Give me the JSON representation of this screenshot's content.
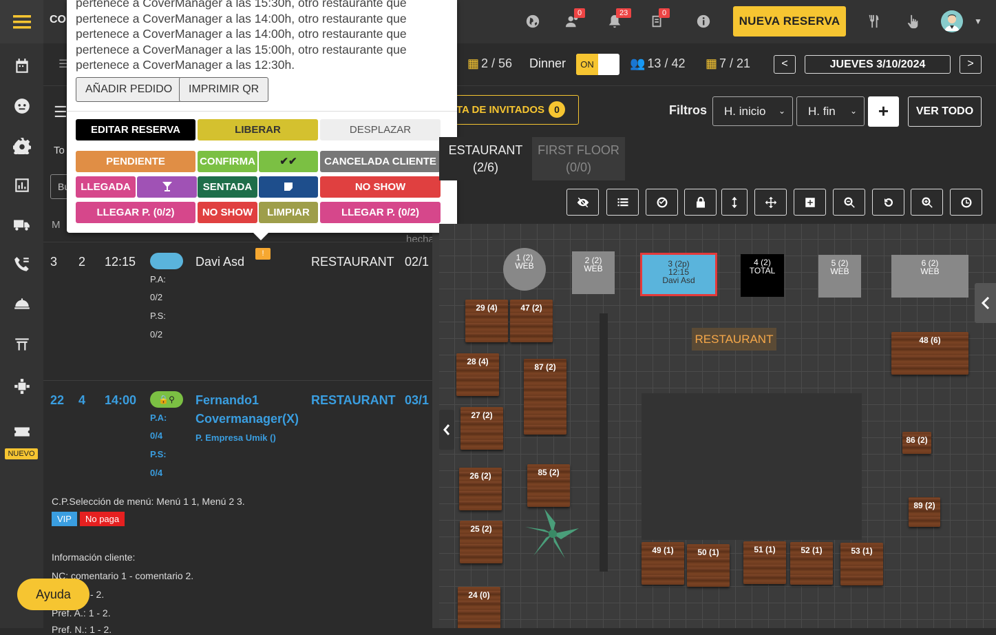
{
  "app": {
    "brand": "CO"
  },
  "sidebar": {
    "nuevo_badge": "NUEVO"
  },
  "topbar": {
    "badges": {
      "users": "0",
      "notifications": "23",
      "tasks": "0"
    },
    "new_reservation": "NUEVA RESERVA"
  },
  "stats": {
    "tables": "2 / 56",
    "service": "Dinner",
    "toggle": "ON",
    "people": "13 / 42",
    "tables2": "7 / 21"
  },
  "date": {
    "prev": "<",
    "label": "JUEVES 3/10/2024",
    "next": ">"
  },
  "filters": {
    "invitados_label": "TA DE INVITADOS",
    "invitados_count": "0",
    "label": "Filtros",
    "h_inicio": "H. inicio",
    "h_fin": "H. fin",
    "plus": "+",
    "ver_todo": "VER TODO"
  },
  "popup": {
    "text": "pertenece a CoverManager a las 15:30h, otro restaurante que pertenece a CoverManager a las 14:00h, otro restaurante que pertenece a CoverManager a las 14:00h, otro restaurante que pertenece a CoverManager a las 15:00h, otro restaurante que pertenece a CoverManager a las 12:30h.",
    "add_order": "AÑADIR PEDIDO",
    "print_qr": "IMPRIMIR QR",
    "actions": {
      "editar": "EDITAR RESERVA",
      "liberar": "LIBERAR",
      "desplazar": "DESPLAZAR",
      "pendiente": "PENDIENTE",
      "confirmada": "CONFIRMA",
      "double_check": "✔✔",
      "cancelada": "CANCELADA CLIENTE",
      "llegada": "LLEGADA",
      "sentada": "SENTADA",
      "no_show": "NO SHOW",
      "llegar_p1": "LLEGAR P. (0/2)",
      "no_show2": "NO SHOW",
      "limpiar": "LIMPIAR",
      "llegar_p2": "LLEGAR P. (0/2)"
    }
  },
  "left": {
    "tab_partial": "To",
    "search_partial": "Bu",
    "col_m": "M",
    "col_hecha": "hecha",
    "rows": [
      {
        "table": "3",
        "pax": "2",
        "time": "12:15",
        "name": "Davi Asd",
        "place": "RESTAURANT",
        "date": "02/1",
        "pa_label": "P.A:",
        "pa": "0/2",
        "ps_label": "P.S:",
        "ps": "0/2",
        "note_badge": "!"
      },
      {
        "table": "22",
        "pax": "4",
        "time": "14:00",
        "name": "Fernando1",
        "name2": "Covermanager(X)",
        "company": "P. Empresa Umik ()",
        "place": "RESTAURANT",
        "date": "03/1",
        "pa_label": "P.A:",
        "pa": "0/4",
        "ps_label": "P.S:",
        "ps": "0/4"
      }
    ],
    "menu_line": "C.P.Selección de menú: Menú 1 1, Menú 2 3.",
    "tag_vip": "VIP",
    "tag_nopaga": "No paga",
    "info_title": "Información cliente:",
    "info_nc": "NC: comentario 1 - comentario 2.",
    "info_2": "- 2.",
    "info_pref": "Pref. A.: 1 - 2.",
    "info_4": "Pref. N.: 1 - 2."
  },
  "floor": {
    "tab_restaurant": "ESTAURANT",
    "tab_restaurant_count": "(2/6)",
    "tab_first": "FIRST FLOOR",
    "tab_first_count": "(0/0)",
    "zone_label": "RESTAURANT",
    "tables": {
      "t1": {
        "name": "1 (2)",
        "sub": "WEB"
      },
      "t2": {
        "name": "2 (2)",
        "sub": "WEB"
      },
      "t3": {
        "name": "3 (2p)",
        "time": "12:15",
        "guest": "Davi Asd"
      },
      "t4": {
        "name": "4 (2)",
        "sub": "TOTAL"
      },
      "t5": {
        "name": "5 (2)",
        "sub": "WEB"
      },
      "t6": {
        "name": "6 (2)",
        "sub": "WEB"
      },
      "t29": "29 (4)",
      "t47": "47 (2)",
      "t48": "48 (6)",
      "t28": "28 (4)",
      "t87": "87 (2)",
      "t27": "27 (2)",
      "t86": "86 (2)",
      "t26": "26 (2)",
      "t85": "85 (2)",
      "t89": "89 (2)",
      "t25": "25 (2)",
      "t49": "49 (1)",
      "t50": "50 (1)",
      "t51": "51 (1)",
      "t52": "52 (1)",
      "t53": "53 (1)",
      "t24": "24 (0)"
    }
  },
  "help": {
    "label": "Ayuda"
  },
  "colors": {
    "accent": "#f6c531",
    "blue_link": "#3a9ee0",
    "selected_table": "#5ab4dc",
    "red_border": "#e43a3a"
  }
}
